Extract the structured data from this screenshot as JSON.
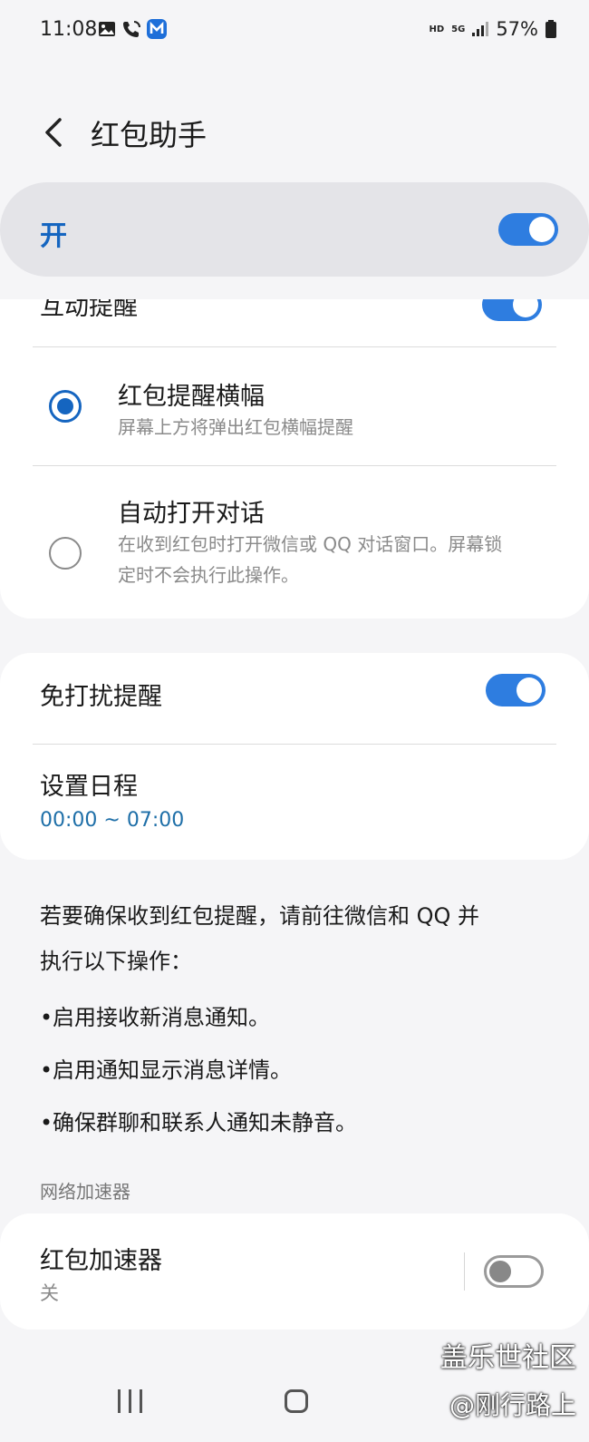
{
  "status_bar": {
    "time": "11:08",
    "hd": "HD",
    "network": "5G",
    "battery": "57%"
  },
  "header": {
    "title": "红包助手"
  },
  "master_switch": {
    "label": "开",
    "state": "on"
  },
  "reminder_options": {
    "partial_row_label": "互动提醒",
    "options": [
      {
        "title": "红包提醒横幅",
        "description": "屏幕上方将弹出红包横幅提醒",
        "selected": true
      },
      {
        "title": "自动打开对话",
        "description_line1": "在收到红包时打开微信或 QQ 对话窗口。屏幕锁",
        "description_line2": "定时不会执行此操作。",
        "selected": false
      }
    ]
  },
  "dnd": {
    "label": "免打扰提醒",
    "state": "on",
    "schedule_label": "设置日程",
    "schedule_value": "00:00 ~ 07:00"
  },
  "info": {
    "intro_line1": "若要确保收到红包提醒，请前往微信和 QQ 并",
    "intro_line2": "执行以下操作：",
    "items": [
      "启用接收新消息通知。",
      "启用通知显示消息详情。",
      "确保群聊和联系人通知未静音。"
    ]
  },
  "accelerator": {
    "section_title": "网络加速器",
    "label": "红包加速器",
    "status": "关",
    "state": "off"
  },
  "watermark": {
    "line1": "盖乐世社区",
    "line2": "@刚行路上"
  },
  "colors": {
    "accent": "#2e7de0",
    "title_blue": "#1565c0",
    "background": "#f5f5f7",
    "card": "#ffffff"
  }
}
